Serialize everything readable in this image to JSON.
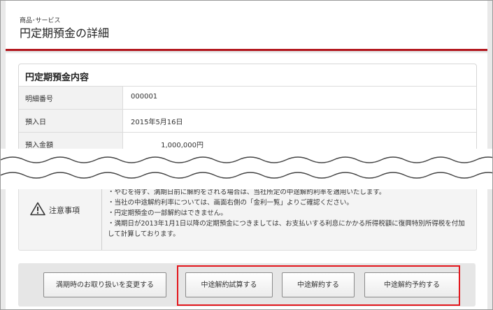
{
  "header": {
    "category": "商品･サービス",
    "title": "円定期預金の詳細"
  },
  "panel": {
    "title": "円定期預金内容",
    "rows": [
      {
        "label": "明細番号",
        "value": "000001"
      },
      {
        "label": "預入日",
        "value": "2015年5月16日"
      },
      {
        "label": "預入金額",
        "value": "1,000,000円"
      }
    ]
  },
  "notice": {
    "title": "注意事項",
    "lines": [
      "・やむを得ず、満期日前に解約をされる場合は、当社所定の中途解約利率を適用いたします。",
      "・当社の中途解約利率については、画面右側の「金利一覧」よりご確認ください。",
      "・円定期預金の一部解約はできません。",
      "・満期日が2013年1月1日以降の定期預金につきましては、お支払いする利息にかかる所得税額に復興特別所得税を付加して計算しております。"
    ]
  },
  "buttons": {
    "change_maturity": "満期時のお取り扱いを変更する",
    "trial_calc": "中途解約試算する",
    "cancel": "中途解約する",
    "reserve_cancel": "中途解約予約する"
  },
  "colors": {
    "accent_red": "#b3151c",
    "highlight_red": "#e3161c"
  }
}
